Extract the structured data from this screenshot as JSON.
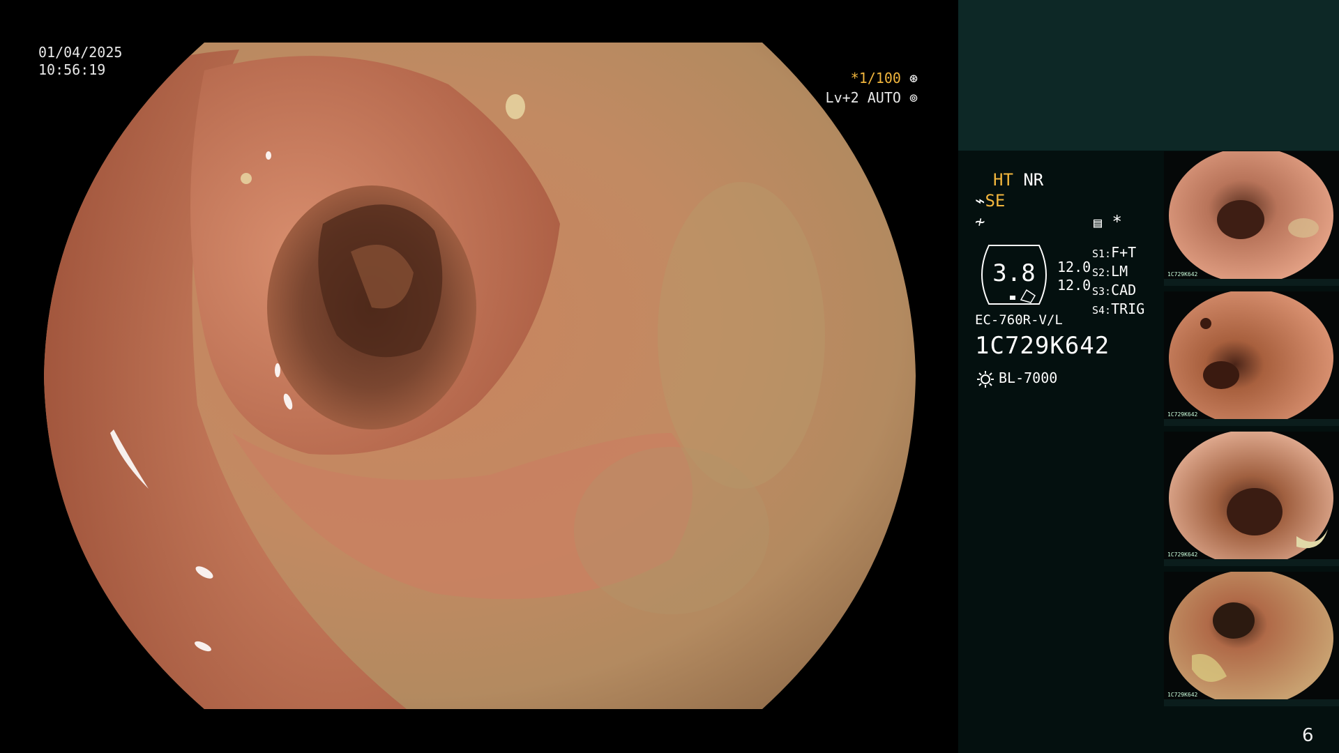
{
  "overlay": {
    "date": "01/04/2025",
    "time": "10:56:19",
    "shutter": "*1/100",
    "level": "Lv+2 AUTO"
  },
  "info": {
    "ht": "HT",
    "nr": "NR",
    "se": "SE",
    "star": "*",
    "gauge_value": "3.8",
    "gauge_nums": [
      "12.0",
      "12.0"
    ],
    "settings": [
      {
        "key": "S1:",
        "value": "F+T"
      },
      {
        "key": "S2:",
        "value": "LM"
      },
      {
        "key": "S3:",
        "value": "CAD"
      },
      {
        "key": "S4:",
        "value": "TRIG"
      }
    ],
    "scope_model": "EC-760R-V/L",
    "scope_serial": "1C729K642",
    "light_source": "BL-7000"
  },
  "thumbnails": [
    {
      "serial": "1C729K642"
    },
    {
      "serial": "1C729K642"
    },
    {
      "serial": "1C729K642"
    },
    {
      "serial": "1C729K642"
    }
  ],
  "page_number": "6",
  "colors": {
    "overlay_orange": "#f2b63d",
    "panel_top": "#0d2826",
    "panel_body": "#04100f",
    "mucosa": "#c07858"
  }
}
